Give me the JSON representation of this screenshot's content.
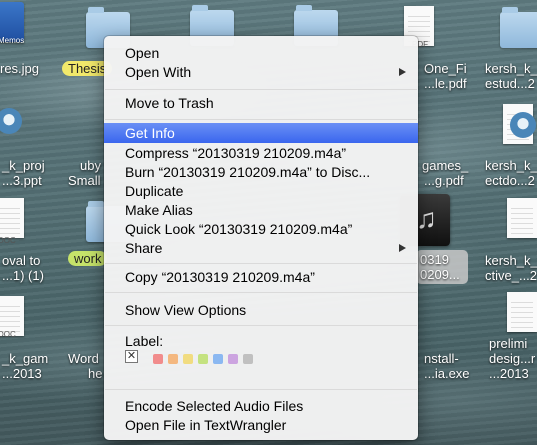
{
  "desktop": {
    "labels": {
      "c0_r0": "res.jpg",
      "c0_r0_tag": "Memos",
      "c0_r1": "_k_proj",
      "c0_r1b": "...3.ppt",
      "c0_r2": "oval to",
      "c0_r2b": "...1) (1)",
      "c0_r3": "_k_gam",
      "c0_r3b": "...2013",
      "tag_thesis": "Thesis",
      "tag_work": "work",
      "mid_r1": "uby",
      "mid_r1b": "Small",
      "mid_r3": "Word",
      "mid_r3b": "he",
      "r_c1_r0": "One_Fi",
      "r_c1_r0b": "...le.pdf",
      "r_c1_r1": "games_",
      "r_c1_r1b": "...g.pdf",
      "r_c1_r2": "0319",
      "r_c1_r2b": "0209...",
      "r_c1_r3": "nstall-",
      "r_c1_r3b": "...ia.exe",
      "r_c2_r0": "kersh_k_",
      "r_c2_r0b": "estud...2",
      "r_c2_r1": "kersh_k_",
      "r_c2_r1b": "ectdo...2",
      "r_c2_r2": "kersh_k_",
      "r_c2_r2b": "ctive_...2",
      "r_c2_r3": "prelimi",
      "r_c2_r3b": "desig...r",
      "r_c2_r3c": "...2013",
      "pdf_tag": "PDF",
      "doc_tag": "DOC"
    }
  },
  "menu": {
    "items": {
      "open": "Open",
      "open_with": "Open With",
      "move_to_trash": "Move to Trash",
      "get_info": "Get Info",
      "compress": "Compress “20130319 210209.m4a”",
      "burn": "Burn “20130319 210209.m4a” to Disc...",
      "duplicate": "Duplicate",
      "make_alias": "Make Alias",
      "quick_look": "Quick Look “20130319 210209.m4a”",
      "share": "Share",
      "copy": "Copy “20130319 210209.m4a”",
      "show_view_options": "Show View Options",
      "label": "Label:",
      "encode": "Encode Selected Audio Files",
      "open_textwrangler": "Open File in TextWrangler"
    },
    "highlighted": "get_info",
    "label_colors": [
      "#f26b6b",
      "#f5a65b",
      "#f2d65b",
      "#b6dd5b",
      "#6aa5f2",
      "#c08bdb",
      "#b0b0b0"
    ],
    "no_label_glyph": "✕"
  },
  "colors": {
    "highlight": "#3a66ee",
    "tag_thesis": "#f2e96b",
    "tag_work": "#c6e36a"
  }
}
